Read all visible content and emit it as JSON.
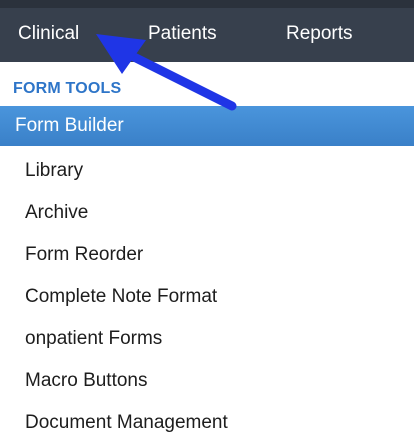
{
  "nav": {
    "tabs": [
      {
        "label": "Clinical"
      },
      {
        "label": "Patients"
      },
      {
        "label": "Reports"
      }
    ]
  },
  "sidebar": {
    "section_title": "FORM TOOLS",
    "items": [
      {
        "label": "Form Builder",
        "selected": true
      },
      {
        "label": "Library"
      },
      {
        "label": "Archive"
      },
      {
        "label": "Form Reorder"
      },
      {
        "label": "Complete Note Format"
      },
      {
        "label": "onpatient Forms"
      },
      {
        "label": "Macro Buttons"
      },
      {
        "label": "Document Management"
      }
    ]
  },
  "colors": {
    "topbar": "#37404d",
    "accent": "#2e75c8",
    "selected": "#4a95dc",
    "annotation_arrow": "#1f35e6"
  },
  "annotation": {
    "icon": "arrow-pointer-icon"
  }
}
